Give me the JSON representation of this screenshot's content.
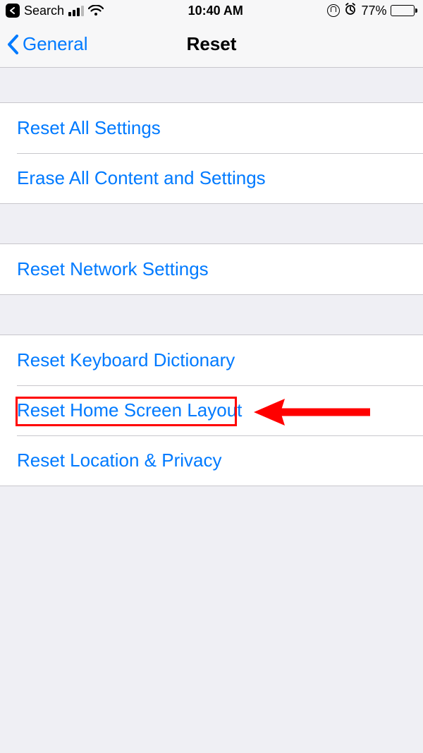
{
  "status": {
    "back_app": "Search",
    "time": "10:40 AM",
    "battery_pct": "77%"
  },
  "nav": {
    "back_label": "General",
    "title": "Reset"
  },
  "groups": [
    {
      "rows": [
        {
          "label": "Reset All Settings"
        },
        {
          "label": "Erase All Content and Settings"
        }
      ]
    },
    {
      "rows": [
        {
          "label": "Reset Network Settings"
        }
      ]
    },
    {
      "rows": [
        {
          "label": "Reset Keyboard Dictionary"
        },
        {
          "label": "Reset Home Screen Layout"
        },
        {
          "label": "Reset Location & Privacy"
        }
      ]
    }
  ],
  "annotation": {
    "highlight_target": "Reset Home Screen Layout"
  }
}
